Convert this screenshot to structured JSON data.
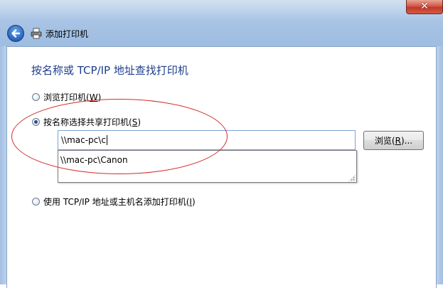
{
  "window": {
    "title": "添加打印机",
    "close_glyph": "✕"
  },
  "page": {
    "heading": "按名称或 TCP/IP 地址查找打印机"
  },
  "options": {
    "browse": {
      "label": "浏览打印机",
      "key": "W",
      "checked": false
    },
    "shared": {
      "label": "按名称选择共享打印机",
      "key": "S",
      "checked": true
    },
    "tcpip": {
      "label": "使用 TCP/IP 地址或主机名添加打印机",
      "key": "I",
      "checked": false
    }
  },
  "shared_input": {
    "value": "\\\\mac-pc\\c"
  },
  "autocomplete": {
    "items": [
      "\\\\mac-pc\\Canon"
    ]
  },
  "browse_button": {
    "label": "浏览",
    "key": "R",
    "suffix": "..."
  },
  "colors": {
    "heading": "#1e3e8c",
    "annotation": "#d22c2c",
    "input_border": "#7ea2d6"
  },
  "icons": {
    "back": "back-arrow-icon",
    "printer": "printer-icon",
    "close": "close-icon"
  }
}
